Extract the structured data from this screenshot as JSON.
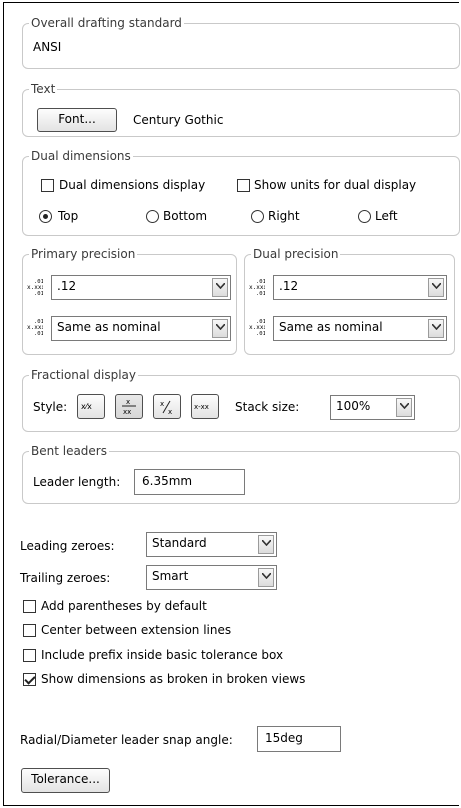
{
  "drafting": {
    "legend": "Overall drafting standard",
    "value": "ANSI"
  },
  "text": {
    "legend": "Text",
    "font_button": "Font...",
    "font_name": "Century Gothic"
  },
  "dual_dimensions": {
    "legend": "Dual dimensions",
    "display_label": "Dual dimensions display",
    "display_checked": false,
    "show_units_label": "Show units for dual display",
    "show_units_checked": false,
    "positions": [
      {
        "label": "Top",
        "checked": true
      },
      {
        "label": "Bottom",
        "checked": false
      },
      {
        "label": "Right",
        "checked": false
      },
      {
        "label": "Left",
        "checked": false
      }
    ]
  },
  "primary_precision": {
    "legend": "Primary precision",
    "value": ".12",
    "tolerance": "Same as nominal"
  },
  "dual_precision": {
    "legend": "Dual precision",
    "value": ".12",
    "tolerance": "Same as nominal"
  },
  "fractional": {
    "legend": "Fractional display",
    "style_label": "Style:",
    "style_buttons": [
      "x/x",
      "x/xx stacked",
      "x/x diagonal",
      "x-xx"
    ],
    "selected_style_index": 1,
    "stack_label": "Stack size:",
    "stack_value": "100%"
  },
  "bent_leaders": {
    "legend": "Bent leaders",
    "length_label": "Leader length:",
    "length_value": "6.35mm"
  },
  "leading_zeroes": {
    "label": "Leading zeroes:",
    "value": "Standard"
  },
  "trailing_zeroes": {
    "label": "Trailing zeroes:",
    "value": "Smart"
  },
  "options": [
    {
      "label": "Add parentheses by default",
      "checked": false
    },
    {
      "label": "Center between extension lines",
      "checked": false
    },
    {
      "label": "Include prefix inside basic tolerance box",
      "checked": false
    },
    {
      "label": "Show dimensions as broken in broken views",
      "checked": true
    }
  ],
  "snap": {
    "label": "Radial/Diameter leader snap angle:",
    "value": "15deg"
  },
  "tolerance_button": "Tolerance...",
  "colors": {
    "group_border": "#c9c9c9",
    "legend_text": "#3a3a3a",
    "control_border": "#7a7a7a"
  }
}
